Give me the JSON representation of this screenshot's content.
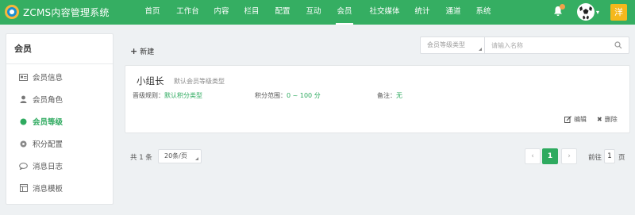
{
  "app": {
    "title": "ZCMS内容管理系统"
  },
  "nav": {
    "items": [
      {
        "label": "首页"
      },
      {
        "label": "工作台"
      },
      {
        "label": "内容"
      },
      {
        "label": "栏目"
      },
      {
        "label": "配置"
      },
      {
        "label": "互动"
      },
      {
        "label": "会员",
        "active": true
      },
      {
        "label": "社交媒体"
      },
      {
        "label": "统计"
      },
      {
        "label": "通道"
      },
      {
        "label": "系统"
      }
    ]
  },
  "user": {
    "tag": "洋"
  },
  "sidebar": {
    "title": "会员",
    "items": [
      {
        "label": "会员信息",
        "icon": "id-card-icon"
      },
      {
        "label": "会员角色",
        "icon": "user-icon"
      },
      {
        "label": "会员等级",
        "icon": "dot-icon",
        "active": true
      },
      {
        "label": "积分配置",
        "icon": "gear-icon"
      },
      {
        "label": "消息日志",
        "icon": "chat-icon"
      },
      {
        "label": "消息模板",
        "icon": "template-icon"
      }
    ]
  },
  "toolbar": {
    "new_label": "新建",
    "select_placeholder": "会员等级类型",
    "search_placeholder": "请输入名称"
  },
  "level_card": {
    "name": "小组长",
    "type": "默认会员等级类型",
    "rule_label": "晋级规则：",
    "rule_value": "默认积分类型",
    "range_label": "积分范围：",
    "range_value": "0 ~ 100 分",
    "note_label": "备注：",
    "note_value": "无",
    "edit_label": "编辑",
    "delete_label": "删除"
  },
  "pagination": {
    "total": "共 1 条",
    "page_size": "20条/页",
    "prev": "‹",
    "current": "1",
    "next": "›",
    "goto_label": "前往",
    "goto_value": "1",
    "goto_suffix": "页"
  },
  "colors": {
    "primary": "#35ae62",
    "accent": "#2eaa5f",
    "badge": "#f2a14a",
    "user_tag": "#f5b81c"
  }
}
